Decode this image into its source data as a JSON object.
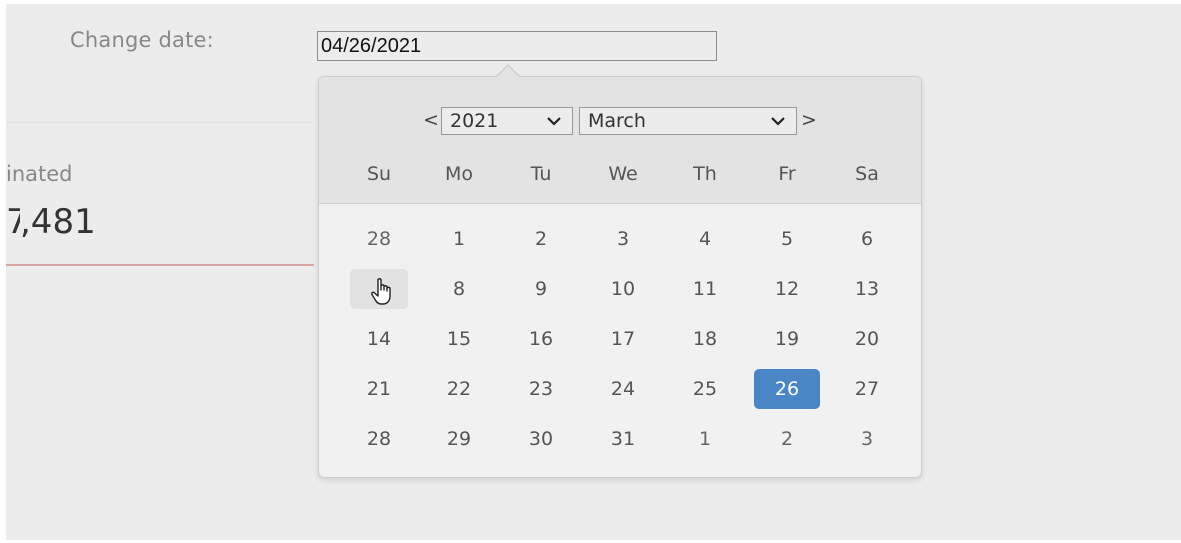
{
  "form": {
    "change_date_label": "Change date:",
    "date_value": "04/26/2021"
  },
  "stat": {
    "label": "inated",
    "value": ",481"
  },
  "datepicker": {
    "prev_label": "<",
    "next_label": ">",
    "year_selected": "2021",
    "month_selected": "March",
    "weekdays": [
      "Su",
      "Mo",
      "Tu",
      "We",
      "Th",
      "Fr",
      "Sa"
    ],
    "weeks": [
      [
        "28",
        "1",
        "2",
        "3",
        "4",
        "5",
        "6"
      ],
      [
        "7",
        "8",
        "9",
        "10",
        "11",
        "12",
        "13"
      ],
      [
        "14",
        "15",
        "16",
        "17",
        "18",
        "19",
        "20"
      ],
      [
        "21",
        "22",
        "23",
        "24",
        "25",
        "26",
        "27"
      ],
      [
        "28",
        "29",
        "30",
        "31",
        "1",
        "2",
        "3"
      ]
    ],
    "selected_day": "26",
    "selected_color": "#4a86c5"
  },
  "icons": {
    "dropdown": "chevron-down-icon",
    "pointer": "hand-pointer-icon"
  }
}
